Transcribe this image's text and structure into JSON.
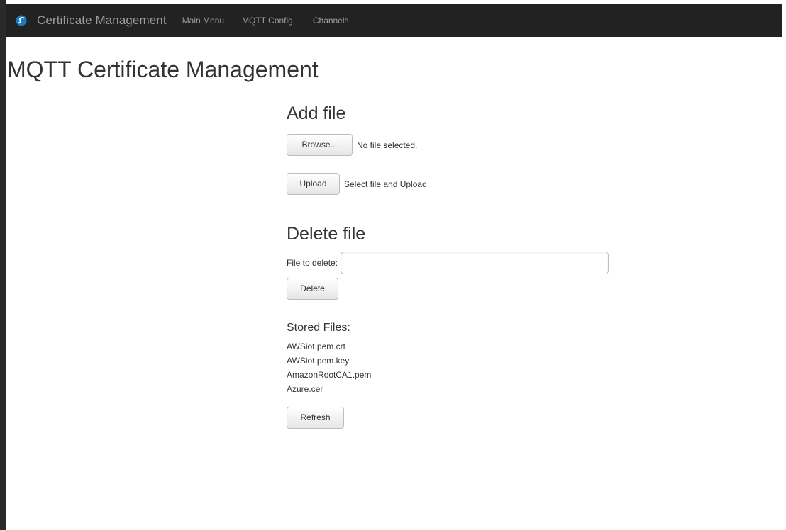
{
  "navbar": {
    "brand": "Certificate Management",
    "items": [
      {
        "label": "Main Menu"
      },
      {
        "label": "MQTT Config"
      },
      {
        "label": "Channels"
      }
    ]
  },
  "page": {
    "title": "MQTT Certificate Management"
  },
  "add_file": {
    "title": "Add file",
    "browse_label": "Browse...",
    "file_status": "No file selected.",
    "upload_label": "Upload",
    "upload_hint": "Select file and Upload"
  },
  "delete_file": {
    "title": "Delete file",
    "field_label": "File to delete:",
    "field_value": "",
    "delete_label": "Delete"
  },
  "stored": {
    "title": "Stored Files:",
    "files": [
      "AWSiot.pem.crt",
      "AWSiot.pem.key",
      "AmazonRootCA1.pem",
      "Azure.cer"
    ],
    "refresh_label": "Refresh"
  },
  "colors": {
    "navbar_bg": "#222222",
    "nav_text": "#9d9d9d",
    "logo_accent": "#1a7bbf"
  },
  "icons": {
    "brand_logo": "logo-icon"
  }
}
